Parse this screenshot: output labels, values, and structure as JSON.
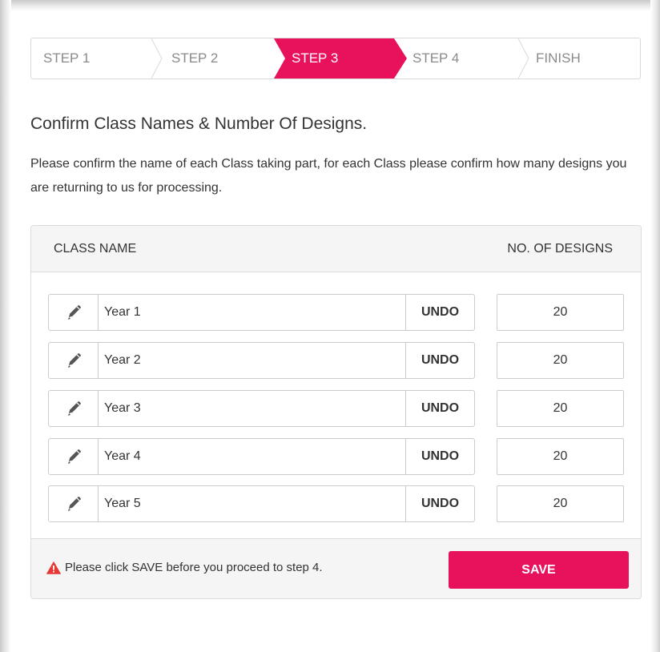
{
  "colors": {
    "accent": "#e8115b",
    "border": "#dcdcdc",
    "panel_bg": "#f5f5f5",
    "warning": "#e53935"
  },
  "stepper": {
    "steps": [
      {
        "label": "STEP 1",
        "active": false
      },
      {
        "label": "STEP 2",
        "active": false
      },
      {
        "label": "STEP 3",
        "active": true
      },
      {
        "label": "STEP 4",
        "active": false
      },
      {
        "label": "FINISH",
        "active": false
      }
    ]
  },
  "page": {
    "title": "Confirm Class Names & Number Of Designs.",
    "description": "Please confirm the name of each Class taking part, for each Class please confirm how many designs you are returning to us for processing."
  },
  "table": {
    "col_class": "CLASS NAME",
    "col_designs": "NO. OF DESIGNS",
    "edit_icon": "pencil-icon",
    "undo_label": "UNDO",
    "rows": [
      {
        "name": "Year 1",
        "designs": "20"
      },
      {
        "name": "Year 2",
        "designs": "20"
      },
      {
        "name": "Year 3",
        "designs": "20"
      },
      {
        "name": "Year 4",
        "designs": "20"
      },
      {
        "name": "Year 5",
        "designs": "20"
      }
    ]
  },
  "footer": {
    "warning_icon": "warning-triangle-icon",
    "warning_text": "Please click SAVE before you proceed to step 4.",
    "save_label": "SAVE"
  }
}
